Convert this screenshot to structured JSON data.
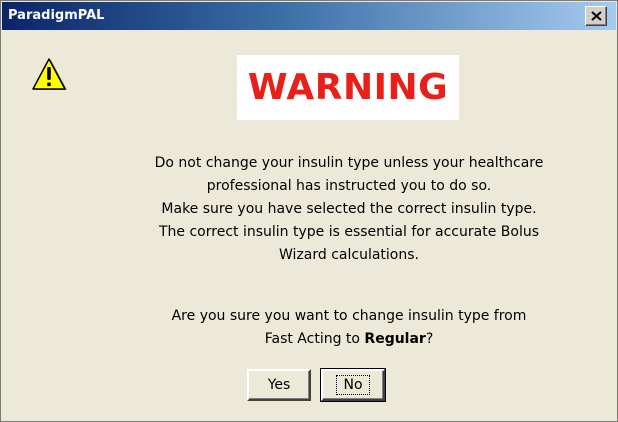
{
  "window": {
    "title": "ParadigmPAL"
  },
  "icons": {
    "warning": "warning-triangle-icon",
    "close": "close-icon"
  },
  "warning_label": "WARNING",
  "message_lines": [
    "Do not change your insulin type unless your healthcare",
    "professional has instructed you to do so.",
    "Make sure you have selected the correct insulin type.",
    "The correct insulin type is essential for accurate Bolus",
    "Wizard calculations."
  ],
  "question": {
    "line1": "Are you sure you want to change insulin type from",
    "line2_prefix": "Fast Acting to ",
    "line2_bold": "Regular",
    "line2_suffix": "?"
  },
  "buttons": {
    "yes": "Yes",
    "no": "No"
  },
  "colors": {
    "warning_red": "#e8201a",
    "dialog_bg": "#ece9d8",
    "titlebar_start": "#0a246a",
    "titlebar_end": "#a6caf0",
    "icon_yellow": "#ffff00"
  }
}
